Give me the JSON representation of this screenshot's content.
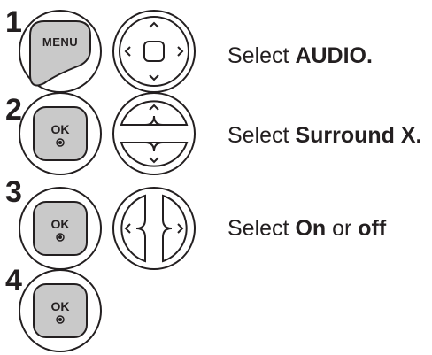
{
  "steps": [
    {
      "number": "1",
      "button_label": "MENU",
      "button_icon": "menu-button-icon",
      "nav_icon": "four-way-navigation-pad-icon",
      "text_prefix": "Select ",
      "text_bold": "AUDIO.",
      "text_mid": "",
      "text_bold2": ""
    },
    {
      "number": "2",
      "button_label": "OK",
      "button_icon": "ok-button-icon",
      "nav_icon": "up-down-navigation-pad-icon",
      "text_prefix": "Select ",
      "text_bold": "Surround X.",
      "text_mid": "",
      "text_bold2": ""
    },
    {
      "number": "3",
      "button_label": "OK",
      "button_icon": "ok-button-icon",
      "nav_icon": "left-right-navigation-pad-icon",
      "text_prefix": "Select ",
      "text_bold": "On",
      "text_mid": " or ",
      "text_bold2": "off"
    },
    {
      "number": "4",
      "button_label": "OK",
      "button_icon": "ok-button-icon"
    }
  ],
  "colors": {
    "text": "#231f20",
    "button_fill": "#c9c9c9",
    "outline": "#231f20"
  }
}
